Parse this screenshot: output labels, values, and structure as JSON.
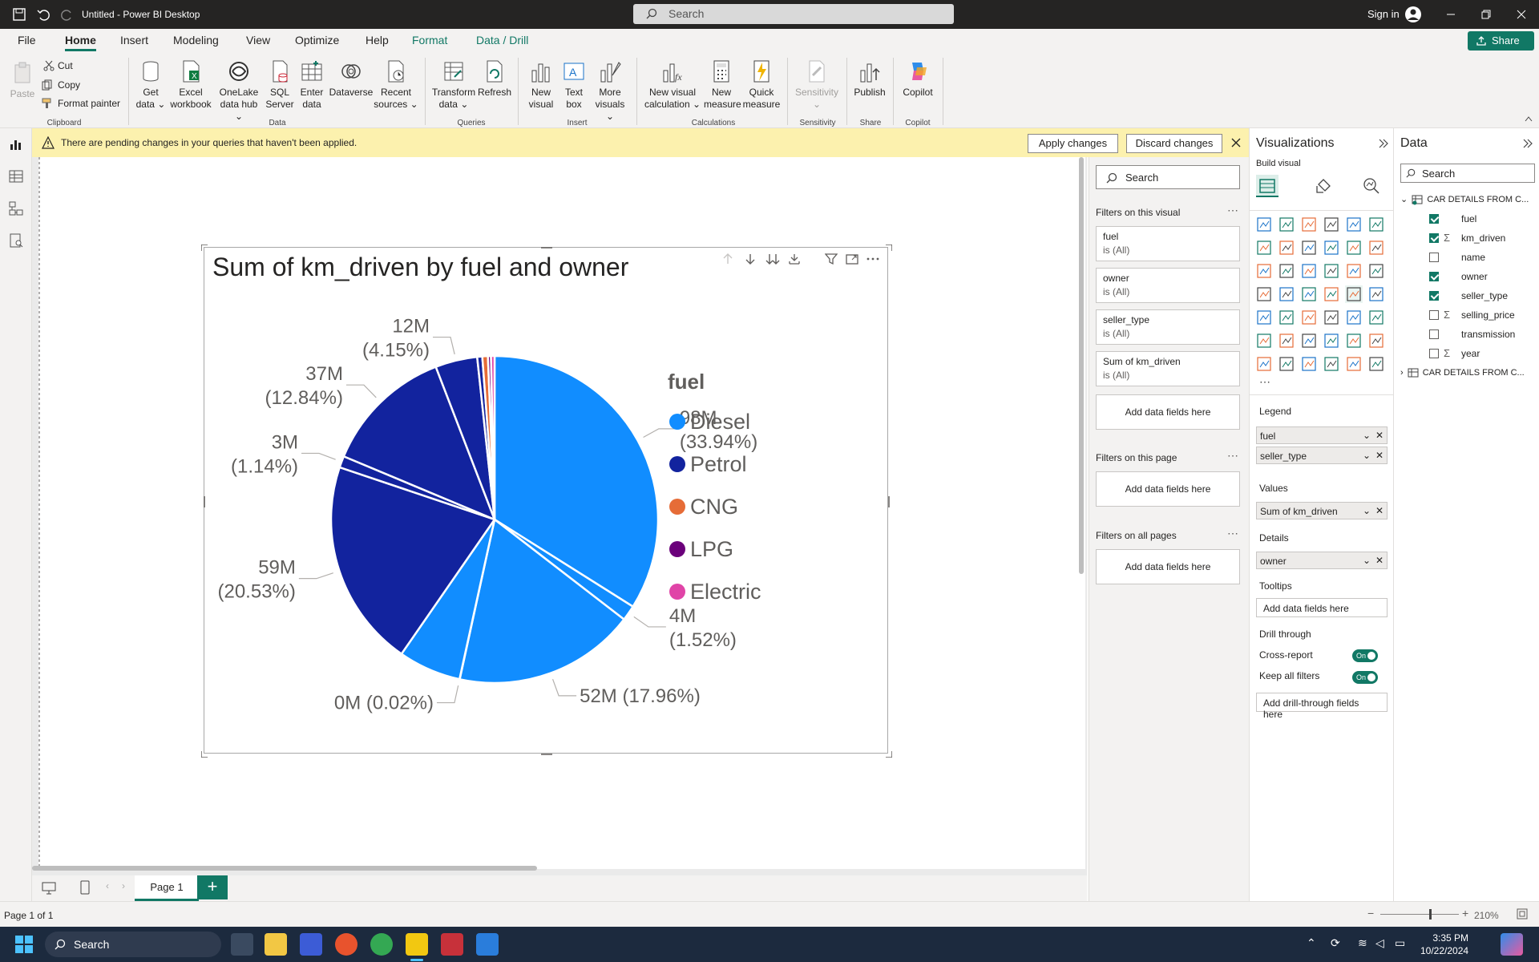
{
  "app": {
    "title": "Untitled - Power BI Desktop",
    "search_placeholder": "Search",
    "sign_in": "Sign in",
    "share": "Share"
  },
  "menu": [
    "File",
    "Home",
    "Insert",
    "Modeling",
    "View",
    "Optimize",
    "Help",
    "Format",
    "Data / Drill"
  ],
  "ribbon": {
    "clipboard": {
      "paste": "Paste",
      "cut": "Cut",
      "copy": "Copy",
      "format_painter": "Format painter",
      "group": "Clipboard"
    },
    "data": {
      "get_data": "Get data",
      "excel": "Excel workbook",
      "onelake": "OneLake data hub",
      "sql": "SQL Server",
      "enter": "Enter data",
      "dataverse": "Dataverse",
      "recent": "Recent sources",
      "group": "Data"
    },
    "queries": {
      "transform": "Transform data",
      "refresh": "Refresh",
      "group": "Queries"
    },
    "insert": {
      "new_visual": "New visual",
      "text_box": "Text box",
      "more_visuals": "More visuals",
      "group": "Insert"
    },
    "calculations": {
      "new_visual_calc": "New visual calculation",
      "new_measure": "New measure",
      "quick_measure": "Quick measure",
      "group": "Calculations"
    },
    "sensitivity": {
      "label": "Sensitivity",
      "group": "Sensitivity"
    },
    "share": {
      "publish": "Publish",
      "group": "Share"
    },
    "copilot": {
      "label": "Copilot",
      "group": "Copilot"
    }
  },
  "notification": {
    "text": "There are pending changes in your queries that haven't been applied.",
    "apply": "Apply changes",
    "discard": "Discard changes"
  },
  "filters": {
    "search": "Search",
    "on_visual": "Filters on this visual",
    "cards": [
      {
        "name": "fuel",
        "state": "is (All)"
      },
      {
        "name": "owner",
        "state": "is (All)"
      },
      {
        "name": "seller_type",
        "state": "is (All)"
      },
      {
        "name": "Sum of km_driven",
        "state": "is (All)"
      }
    ],
    "add_fields": "Add data fields here",
    "on_page": "Filters on this page",
    "on_all": "Filters on all pages"
  },
  "visualizations": {
    "title": "Visualizations",
    "build": "Build visual",
    "legend_label": "Legend",
    "legend_fields": [
      "fuel",
      "seller_type"
    ],
    "values_label": "Values",
    "values_field": "Sum of km_driven",
    "details_label": "Details",
    "details_field": "owner",
    "tooltips_label": "Tooltips",
    "tooltips_add": "Add data fields here",
    "drill_label": "Drill through",
    "cross_report": "Cross-report",
    "keep_filters": "Keep all filters",
    "toggle_on": "On",
    "drill_add": "Add drill-through fields here"
  },
  "data_pane": {
    "title": "Data",
    "search": "Search",
    "table1": "CAR DETAILS FROM C...",
    "table2": "CAR DETAILS FROM C...",
    "fields": [
      {
        "name": "fuel",
        "checked": true,
        "sigma": false
      },
      {
        "name": "km_driven",
        "checked": true,
        "sigma": true
      },
      {
        "name": "name",
        "checked": false,
        "sigma": false
      },
      {
        "name": "owner",
        "checked": true,
        "sigma": false
      },
      {
        "name": "seller_type",
        "checked": true,
        "sigma": false
      },
      {
        "name": "selling_price",
        "checked": false,
        "sigma": true
      },
      {
        "name": "transmission",
        "checked": false,
        "sigma": false
      },
      {
        "name": "year",
        "checked": false,
        "sigma": true
      }
    ]
  },
  "pages": {
    "tab": "Page 1",
    "count": "Page 1 of 1",
    "zoom": "210%"
  },
  "taskbar": {
    "search": "Search",
    "time": "3:35 PM",
    "date": "10/22/2024"
  },
  "chart_data": {
    "type": "pie",
    "title": "Sum of km_driven by fuel and owner",
    "legend_title": "fuel",
    "legend_position": "right",
    "legend": [
      {
        "name": "Diesel",
        "color": "#118dff"
      },
      {
        "name": "Petrol",
        "color": "#12239e"
      },
      {
        "name": "CNG",
        "color": "#e66c37"
      },
      {
        "name": "LPG",
        "color": "#6b007b"
      },
      {
        "name": "Electric",
        "color": "#e044a7"
      }
    ],
    "slices": [
      {
        "fuel": "Diesel",
        "value": 98,
        "pct": 33.94,
        "label": "98M",
        "pct_label": "(33.94%)",
        "color": "#118dff"
      },
      {
        "fuel": "Diesel",
        "value": 4,
        "pct": 1.52,
        "label": "4M",
        "pct_label": "(1.52%)",
        "color": "#118dff"
      },
      {
        "fuel": "Diesel",
        "value": 52,
        "pct": 17.96,
        "label": "52M (17.96%)",
        "pct_label": "",
        "color": "#118dff"
      },
      {
        "fuel": "Diesel",
        "value": 0,
        "pct": 0.02,
        "label": "0M (0.02%)",
        "pct_label": "",
        "color": "#118dff"
      },
      {
        "fuel": "Diesel",
        "value": 18,
        "pct": 6.2,
        "label": "",
        "pct_label": "",
        "color": "#118dff"
      },
      {
        "fuel": "Petrol",
        "value": 59,
        "pct": 20.53,
        "label": "59M",
        "pct_label": "(20.53%)",
        "color": "#12239e"
      },
      {
        "fuel": "Petrol",
        "value": 3,
        "pct": 1.14,
        "label": "3M",
        "pct_label": "(1.14%)",
        "color": "#12239e"
      },
      {
        "fuel": "Petrol",
        "value": 37,
        "pct": 12.84,
        "label": "37M",
        "pct_label": "(12.84%)",
        "color": "#12239e"
      },
      {
        "fuel": "Petrol",
        "value": 12,
        "pct": 4.15,
        "label": "12M",
        "pct_label": "(4.15%)",
        "color": "#12239e"
      },
      {
        "fuel": "Petrol",
        "value": 1,
        "pct": 0.5,
        "label": "",
        "pct_label": "",
        "color": "#12239e"
      },
      {
        "fuel": "CNG",
        "value": 1,
        "pct": 0.55,
        "label": "",
        "pct_label": "",
        "color": "#e66c37"
      },
      {
        "fuel": "LPG",
        "value": 1,
        "pct": 0.3,
        "label": "",
        "pct_label": "",
        "color": "#6b007b"
      },
      {
        "fuel": "Electric",
        "value": 1,
        "pct": 0.35,
        "label": "",
        "pct_label": "",
        "color": "#e044a7"
      }
    ]
  }
}
